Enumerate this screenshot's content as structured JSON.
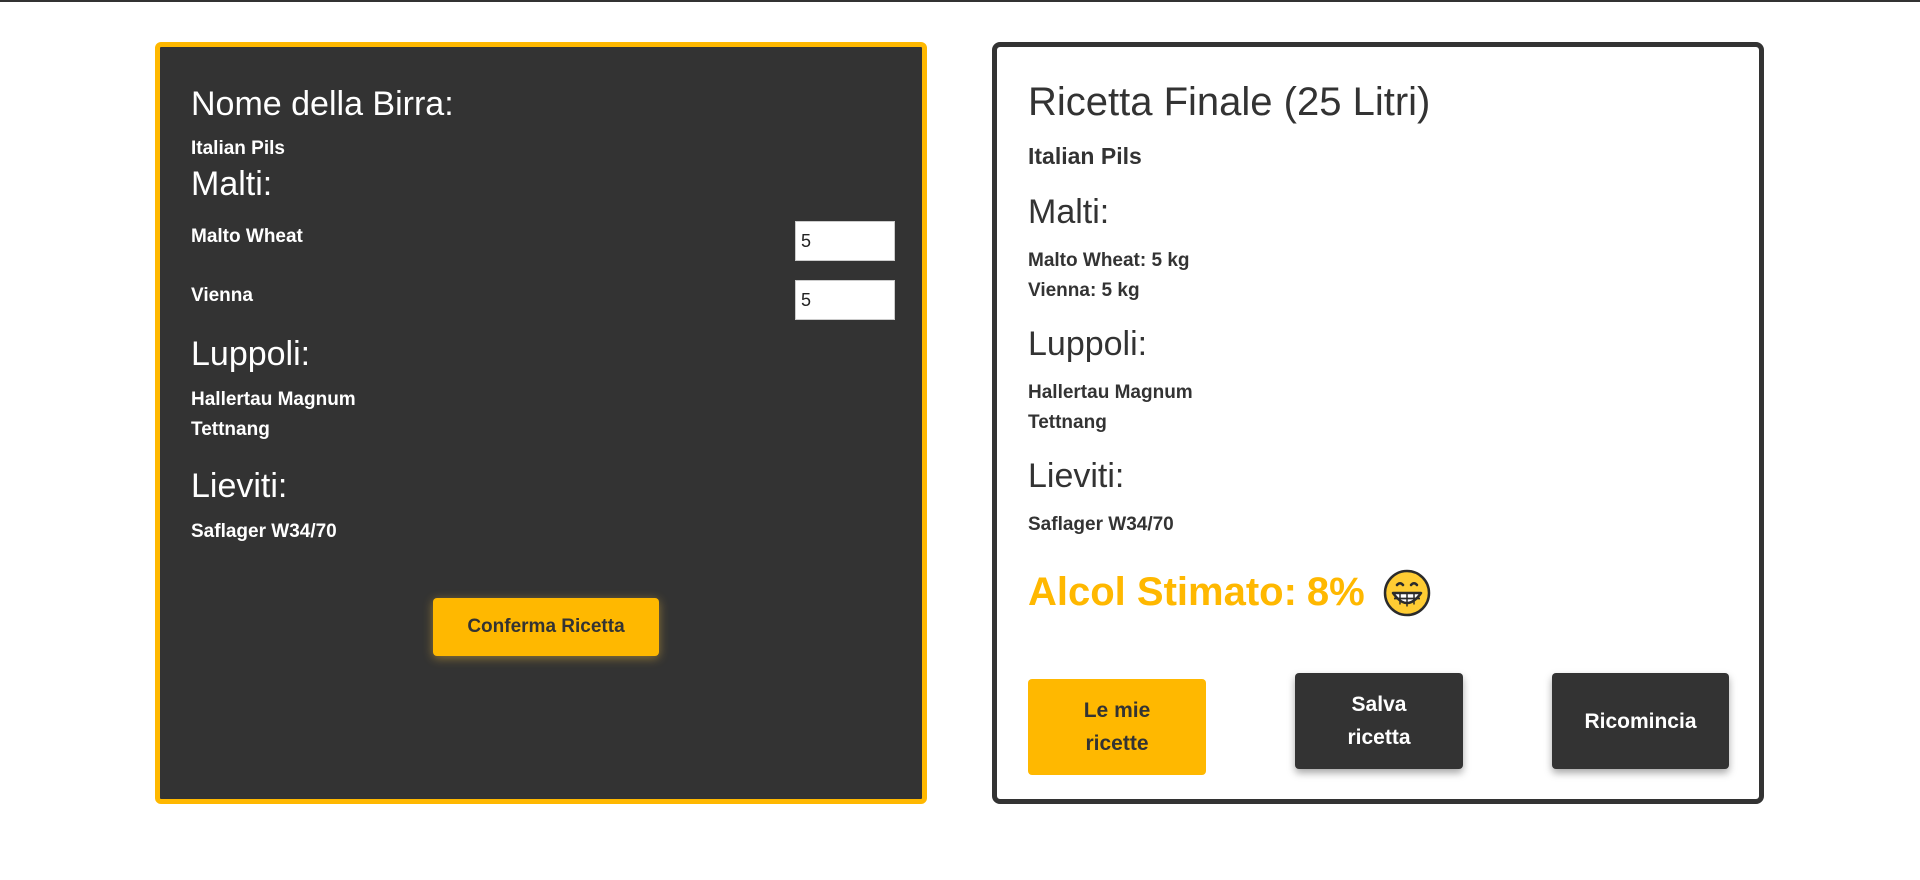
{
  "left_panel": {
    "beer_name_label": "Nome della Birra:",
    "beer_name": "Italian Pils",
    "malts_label": "Malti:",
    "malts": [
      {
        "name": "Malto Wheat",
        "quantity": "5"
      },
      {
        "name": "Vienna",
        "quantity": "5"
      }
    ],
    "hops_label": "Luppoli:",
    "hops": [
      "Hallertau Magnum",
      "Tettnang"
    ],
    "yeasts_label": "Lieviti:",
    "yeasts": [
      "Saflager W34/70"
    ],
    "confirm_button": "Conferma Ricetta"
  },
  "right_panel": {
    "title": "Ricetta Finale (25 Litri)",
    "beer_name": "Italian Pils",
    "malts_label": "Malti:",
    "malts": [
      "Malto Wheat: 5 kg",
      "Vienna: 5 kg"
    ],
    "hops_label": "Luppoli:",
    "hops": [
      "Hallertau Magnum",
      "Tettnang"
    ],
    "yeasts_label": "Lieviti:",
    "yeasts": [
      "Saflager W34/70"
    ],
    "alcohol_label": "Alcol Stimato:",
    "alcohol_value": "8%",
    "alcohol_icon": "grinning-face-icon",
    "buttons": {
      "my_recipes": "Le mie ricette",
      "save": "Salva ricetta",
      "restart": "Ricomincia"
    }
  },
  "colors": {
    "accent": "#ffb800",
    "dark": "#333333",
    "light": "#ffffff"
  }
}
